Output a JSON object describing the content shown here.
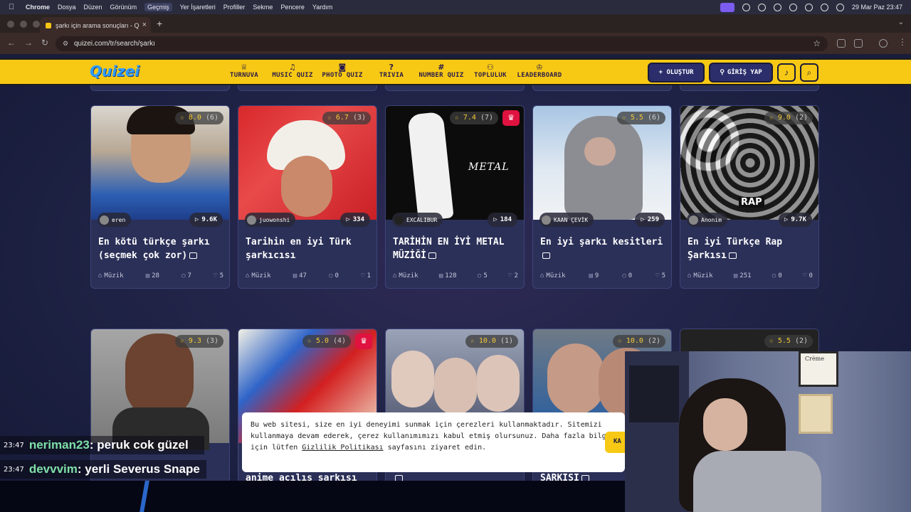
{
  "os_menubar": {
    "app": "Chrome",
    "menus": [
      "Dosya",
      "Düzen",
      "Görünüm",
      "Geçmiş",
      "Yer İşaretleri",
      "Profiller",
      "Sekme",
      "Pencere",
      "Yardım"
    ],
    "datetime": "29 Mar Paz  23:47"
  },
  "browser": {
    "tab_title": "şarkı için arama sonuçları - Q",
    "url": "quizei.com/tr/search/şarkı"
  },
  "header": {
    "logo": "Quizei",
    "nav": [
      {
        "label": "TURNUVA",
        "icon": "trophy-icon"
      },
      {
        "label": "MUSIC QUIZ",
        "icon": "music-icon"
      },
      {
        "label": "PHOTO QUIZ",
        "icon": "camera-icon"
      },
      {
        "label": "TRIVIA",
        "icon": "question-icon"
      },
      {
        "label": "NUMBER QUIZ",
        "icon": "hash-icon"
      },
      {
        "label": "TOPLULUK",
        "icon": "users-icon"
      },
      {
        "label": "LEADERBOARD",
        "icon": "medal-icon"
      }
    ],
    "create_label": "+ OLUŞTUR",
    "login_label": "GİRİŞ YAP",
    "accent": "#f7c914"
  },
  "cards_row1": [
    {
      "rating": "8.0",
      "votes": "(6)",
      "premium": false,
      "author": "eren",
      "plays": "9.6K",
      "title": "En kötü türkçe şarkı (seçmek çok zor)",
      "category": "Müzik",
      "items": "28",
      "comments": "7",
      "likes": "5"
    },
    {
      "rating": "6.7",
      "votes": "(3)",
      "premium": false,
      "author": "juowonshi",
      "plays": "334",
      "title": "Tarihin en iyi Türk şarkıcısı",
      "category": "Müzik",
      "items": "47",
      "comments": "0",
      "likes": "1"
    },
    {
      "rating": "7.4",
      "votes": "(7)",
      "premium": true,
      "author": "EXCALIBUR",
      "plays": "184",
      "title": "TARİHİN EN İYİ METAL MÜZİĞİ",
      "category": "Müzik",
      "items": "128",
      "comments": "5",
      "likes": "2",
      "img_text": "METAL"
    },
    {
      "rating": "5.5",
      "votes": "(6)",
      "premium": false,
      "author": "KAAN ÇEVİK",
      "plays": "259",
      "title": "En iyi şarkı kesitleri",
      "category": "Müzik",
      "items": "9",
      "comments": "0",
      "likes": "5"
    },
    {
      "rating": "9.0",
      "votes": "(2)",
      "premium": false,
      "author": "Anonim",
      "plays": "9.7K",
      "title": "En iyi Türkçe Rap Şarkısı",
      "category": "Müzik",
      "items": "251",
      "comments": "0",
      "likes": "0",
      "img_text": "RAP"
    }
  ],
  "cards_row2": [
    {
      "rating": "9.3",
      "votes": "(3)",
      "premium": false
    },
    {
      "rating": "5.0",
      "votes": "(4)",
      "premium": true,
      "partial_title": "anime açılış şarkısı"
    },
    {
      "rating": "10.0",
      "votes": "(1)",
      "premium": false
    },
    {
      "rating": "10.0",
      "votes": "(2)",
      "premium": false,
      "partial_title": "ŞARKISI"
    },
    {
      "rating": "5.5",
      "votes": "(2)",
      "premium": false
    }
  ],
  "cookie_banner": {
    "text_before": "Bu web sitesi, size en iyi deneyimi sunmak için çerezleri kullanmaktadır. Sitemizi kullanmaya devam ederek, çerez kullanımımızı kabul etmiş olursunuz. Daha fazla bilgi için lütfen ",
    "link": "Gizlilik Politikası",
    "text_after": " sayfasını ziyaret edin.",
    "button": "KA"
  },
  "chat": [
    {
      "time": "23:47",
      "user": "neriman23",
      "message": ": peruk cok güzel"
    },
    {
      "time": "23:47",
      "user": "devvvim",
      "message": ": yerli Severus Snape"
    }
  ],
  "cam_wall_text": "Crème"
}
